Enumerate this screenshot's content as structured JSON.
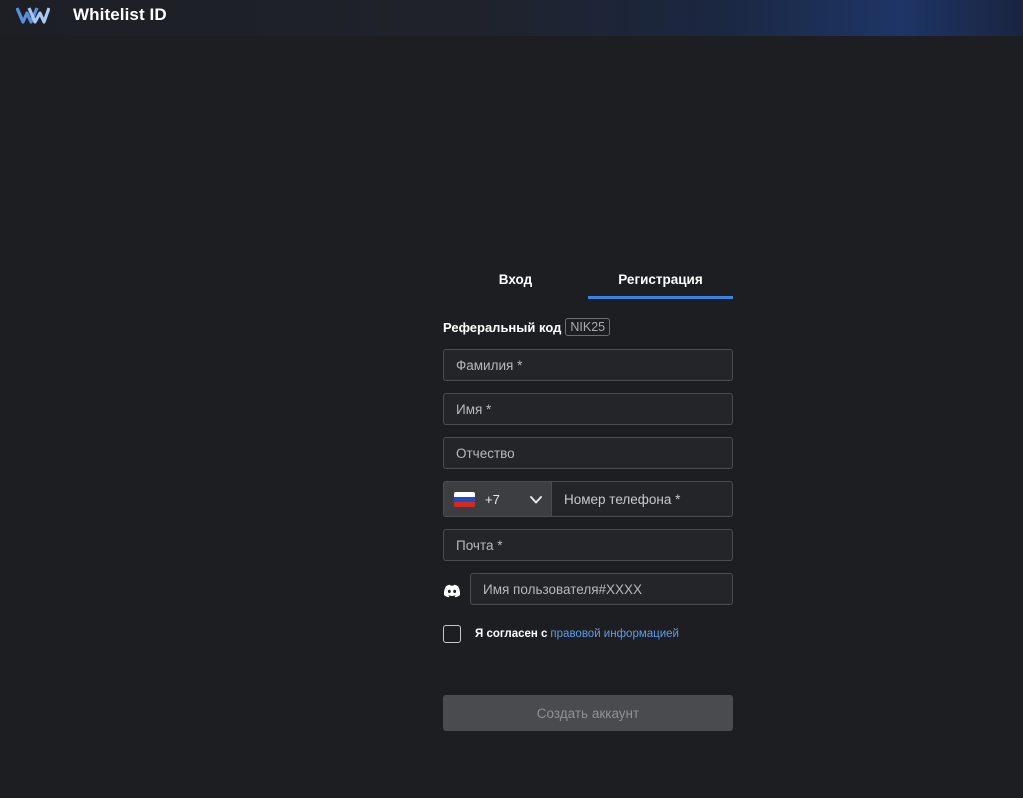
{
  "header": {
    "app_title": "Whitelist ID",
    "logo_icon": "whitelist-logo-icon"
  },
  "tabs": [
    {
      "label": "Вход",
      "active": false
    },
    {
      "label": "Регистрация",
      "active": true
    }
  ],
  "referral": {
    "label": "Реферальный код",
    "code": "NIK25"
  },
  "form": {
    "last_name_placeholder": "Фамилия *",
    "first_name_placeholder": "Имя *",
    "middle_name_placeholder": "Отчество",
    "phone": {
      "country_flag": "russia-flag-icon",
      "country_code": "+7",
      "placeholder": "Номер телефона *"
    },
    "email_placeholder": "Почта *",
    "discord": {
      "icon": "discord-icon",
      "placeholder": "Имя пользователя#XXXX"
    },
    "agree": {
      "text": "Я согласен с",
      "link_text": "правовой информацией",
      "checked": false
    },
    "submit_label": "Создать аккаунт"
  },
  "colors": {
    "accent": "#3b82e6",
    "link": "#5f9be8",
    "background": "#1d1e21",
    "disabled_button": "#4a4b4f"
  }
}
